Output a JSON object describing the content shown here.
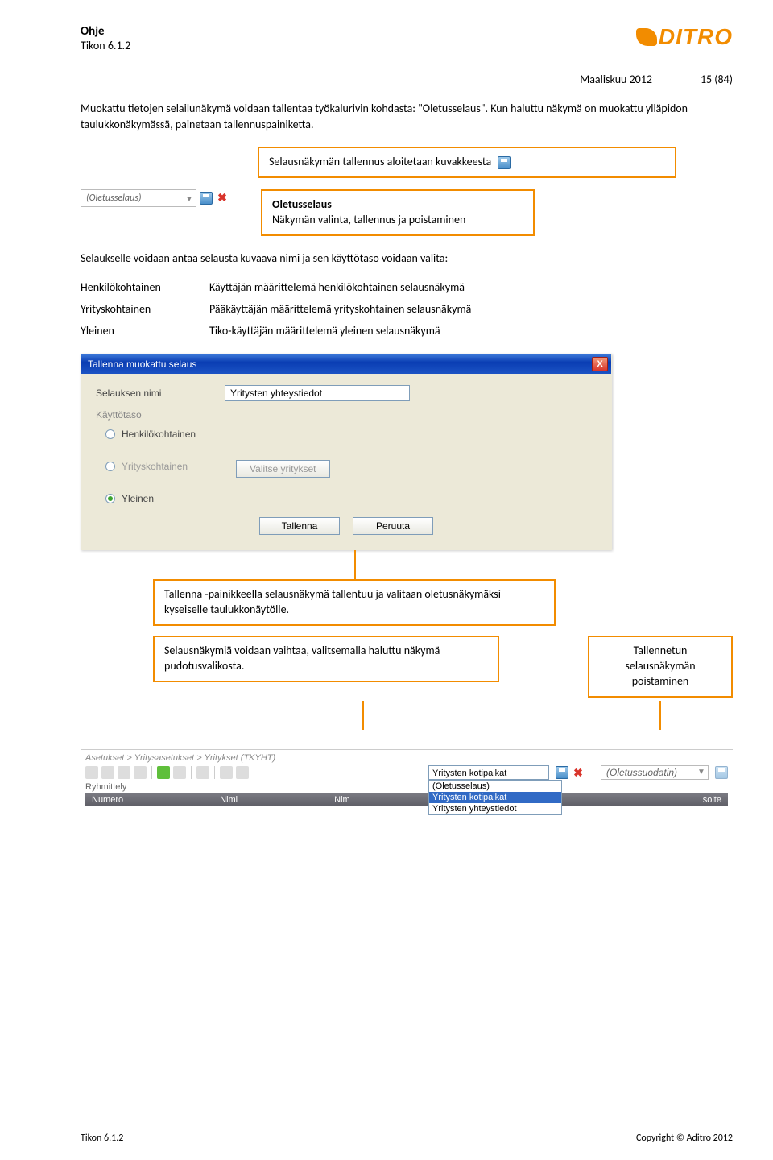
{
  "header": {
    "title": "Ohje",
    "subtitle": "Tikon 6.1.2",
    "logo_text": "DITRO"
  },
  "meta": {
    "date": "Maaliskuu 2012",
    "page": "15 (84)"
  },
  "intro": "Muokattu tietojen selailunäkymä voidaan tallentaa työkalurivin kohdasta: \"Oletusselaus\". Kun haluttu näkymä on muokattu ylläpidon taulukkonäkymässä, painetaan tallennuspainiketta.",
  "callout1": "Selausnäkymän tallennus aloitetaan kuvakkeesta",
  "dropdown1": {
    "text": "(Oletusselaus)"
  },
  "callout2": {
    "title": "Oletusselaus",
    "body": "Näkymän valinta, tallennus ja poistaminen"
  },
  "subhead": "Selaukselle voidaan antaa selausta kuvaava nimi ja sen käyttötaso voidaan valita:",
  "defs": [
    {
      "term": "Henkilökohtainen",
      "desc": "Käyttäjän määrittelemä henkilökohtainen selausnäkymä"
    },
    {
      "term": "Yrityskohtainen",
      "desc": "Pääkäyttäjän määrittelemä yrityskohtainen selausnäkymä"
    },
    {
      "term": "Yleinen",
      "desc": "Tiko-käyttäjän määrittelemä yleinen selausnäkymä"
    }
  ],
  "dialog": {
    "title": "Tallenna muokattu selaus",
    "field_label": "Selauksen nimi",
    "field_value": "Yritysten yhteystiedot",
    "group_label": "Käyttötaso",
    "radio1": "Henkilökohtainen",
    "radio2": "Yrityskohtainen",
    "radio3": "Yleinen",
    "select_btn": "Valitse yritykset",
    "save_btn": "Tallenna",
    "cancel_btn": "Peruuta"
  },
  "callout3": "Tallenna -painikkeella selausnäkymä tallentuu ja valitaan oletusnäkymäksi kyseiselle taulukkonäytölle.",
  "callout4": "Selausnäkymiä voidaan vaihtaa, valitsemalla haluttu näkymä pudotusvalikosta.",
  "callout5": "Tallennetun selausnäkymän poistaminen",
  "toolbar": {
    "breadcrumb": "Asetukset > Yritysasetukset > Yritykset (TKYHT)",
    "group_label": "Ryhmittely",
    "dd_value": "Yritysten kotipaikat",
    "dd_items": [
      "(Oletusselaus)",
      "Yritysten kotipaikat",
      "Yritysten yhteystiedot"
    ],
    "filter_value": "(Oletussuodatin)",
    "col1": "Numero",
    "col2": "Nimi",
    "col3": "Nim",
    "col4": "soite"
  },
  "footer": {
    "left": "Tikon 6.1.2",
    "right": "Copyright © Aditro 2012"
  }
}
